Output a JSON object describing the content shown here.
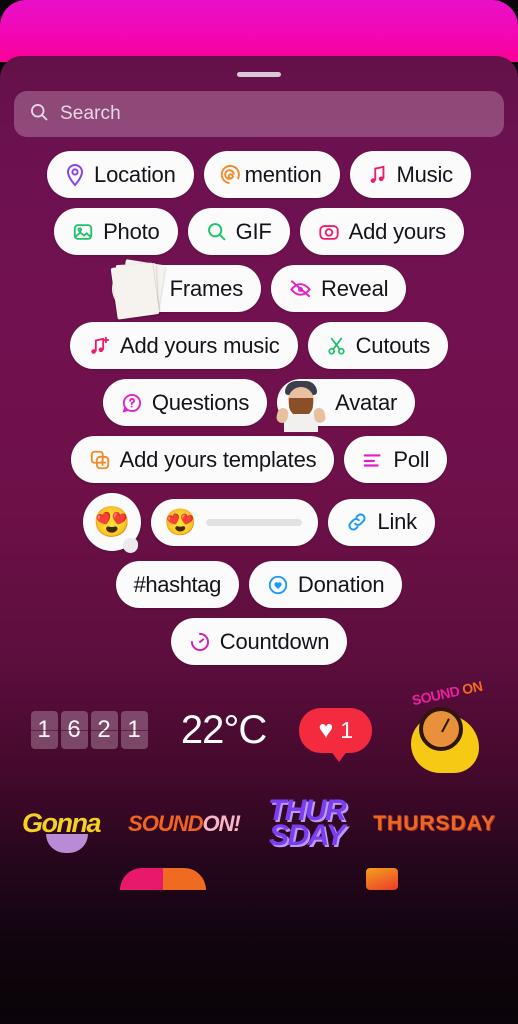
{
  "search": {
    "placeholder": "Search",
    "icon": "search-icon"
  },
  "stickers": {
    "rows": [
      [
        {
          "label": "Location",
          "icon": "location-pin-icon",
          "color": "#8b44e0"
        },
        {
          "label": "mention",
          "icon": "mention-spiral-icon",
          "color": "#f08a27"
        },
        {
          "label": "Music",
          "icon": "music-note-icon",
          "color": "#ee1b6b"
        }
      ],
      [
        {
          "label": "Photo",
          "icon": "photo-icon",
          "color": "#1fc26b"
        },
        {
          "label": "GIF",
          "icon": "gif-search-icon",
          "color": "#1fc26b"
        },
        {
          "label": "Add yours",
          "icon": "camera-icon",
          "color": "#ef2069"
        }
      ],
      [
        {
          "label": "Frames",
          "icon": "polaroid-stack-icon",
          "color": "#f6f3ee"
        },
        {
          "label": "Reveal",
          "icon": "eye-slash-icon",
          "color": "#e020c9"
        }
      ],
      [
        {
          "label": "Add yours music",
          "icon": "music-note-plus-icon",
          "color": "#ee1b6b"
        },
        {
          "label": "Cutouts",
          "icon": "scissors-icon",
          "color": "#1fc26b"
        }
      ],
      [
        {
          "label": "Questions",
          "icon": "question-bubble-icon",
          "color": "#e020c9"
        },
        {
          "label": "Avatar",
          "icon": "avatar-icon",
          "color": "#e8c0a0"
        }
      ],
      [
        {
          "label": "Add yours templates",
          "icon": "templates-plus-icon",
          "color": "#f08a27"
        },
        {
          "label": "Poll",
          "icon": "poll-bars-icon",
          "color": "#e020c9"
        }
      ],
      [
        {
          "label": "Link",
          "icon": "link-chain-icon",
          "color": "#1c9bf0"
        }
      ],
      [
        {
          "label": "#hashtag",
          "icon": "hashtag-icon",
          "color": "#e020c9"
        },
        {
          "label": "Donation",
          "icon": "donation-heart-icon",
          "color": "#1c9bf0"
        }
      ],
      [
        {
          "label": "Countdown",
          "icon": "countdown-timer-icon",
          "color": "#d41fb0"
        }
      ]
    ],
    "emoji_reaction": {
      "emoji": "😍",
      "name": "emoji-reaction-bubble"
    },
    "emoji_slider": {
      "emoji": "😍",
      "name": "emoji-slider-sticker"
    }
  },
  "dynamic_stickers": {
    "clock": {
      "digits": [
        "1",
        "6",
        "2",
        "1"
      ]
    },
    "temperature": "22°C",
    "like_count": {
      "heart": "♥",
      "count": "1"
    },
    "sound_on": {
      "text_part1": "SOUND",
      "text_part2": "ON"
    }
  },
  "gif_stickers": [
    {
      "label": "Gonna",
      "name": "gif-gonna"
    },
    {
      "label": "SOUND",
      "label2": "ON!",
      "name": "gif-sound-on"
    },
    {
      "label": "THUR",
      "label2": "SDAY",
      "name": "gif-thursday-graffiti"
    },
    {
      "label": "THURSDAY",
      "name": "gif-thursday-text"
    }
  ]
}
